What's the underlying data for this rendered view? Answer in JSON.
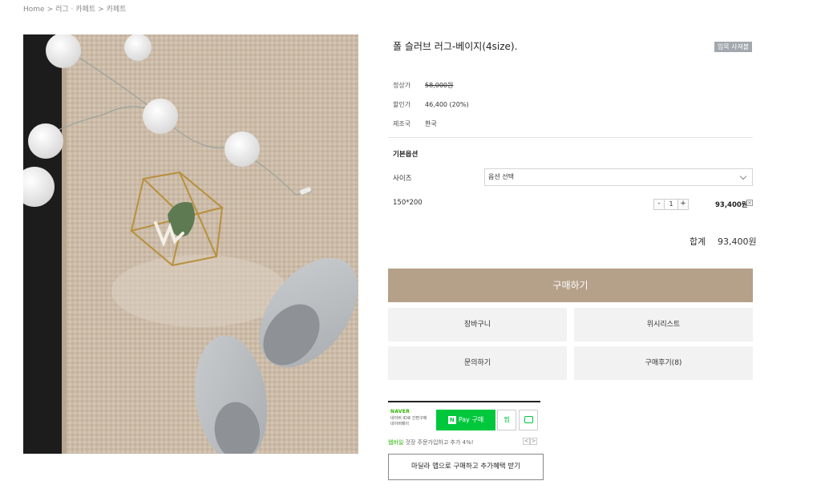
{
  "breadcrumb": {
    "items": [
      "Home",
      "러그 · 카페트",
      "카페트"
    ],
    "separator": ">"
  },
  "product": {
    "title": "폴 슬러브 러그-베이지(4size).",
    "badge": "입목 사져볼",
    "specs": {
      "regular_price_label": "정상가",
      "regular_price": "58,000원",
      "sale_price_label": "할인가",
      "sale_price": "46,400 (20%)",
      "origin_label": "제조국",
      "origin": "한국"
    }
  },
  "options": {
    "heading": "기본옵션",
    "size_label": "사이즈",
    "size_select_value": "옵션 선택",
    "selected_item": {
      "size": "150*200",
      "quantity": "1",
      "minus": "-",
      "plus": "+",
      "price": "93,400원",
      "remove": "×"
    }
  },
  "total": {
    "label": "합계",
    "value": "93,400원"
  },
  "actions": {
    "buy": "구매하기",
    "cart": "장바구니",
    "wishlist": "위시리스트",
    "inquiry": "문의하기",
    "reviews": "구매후기(8)"
  },
  "naver_pay": {
    "brand": "NAVER",
    "desc_line1": "네이버 ID로 간편구매",
    "desc_line2": "네이버페이",
    "logo_letter": "N",
    "pay_label": "Pay 구매",
    "zzim_label": "찜",
    "promo_highlight": "웹바일",
    "promo_text": " 것장 주문가입하고 추가 4%!",
    "prev": "<",
    "next": ">"
  },
  "app_benefit_button": "마딜라 앱으로 구매하고 추가혜택 받기",
  "colors": {
    "buy_button": "#b5a08a",
    "secondary_button": "#f2f2f2",
    "naver_green": "#00c73c",
    "badge": "#a2a8ad"
  },
  "icons": [
    "chevron-down-icon",
    "remove-icon",
    "naver-pay-logo-icon",
    "talk-bubble-icon"
  ]
}
